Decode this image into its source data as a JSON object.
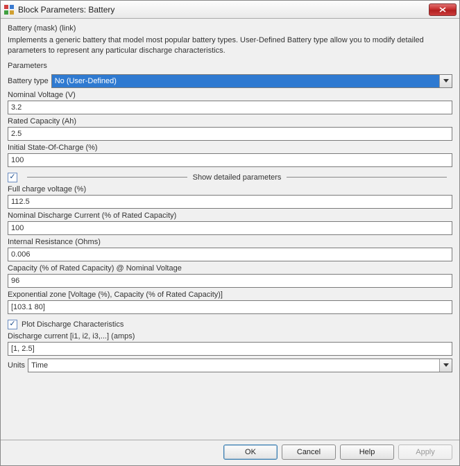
{
  "title": "Block Parameters: Battery",
  "mask_heading": "Battery (mask) (link)",
  "description": "Implements a generic battery that model most popular battery types. User-Defined Battery type allow you to modify detailed parameters  to represent any particular discharge characteristics.",
  "parameters_heading": "Parameters",
  "battery_type": {
    "label": "Battery type",
    "value": "No (User-Defined)"
  },
  "fields": {
    "nominal_voltage": {
      "label": "Nominal Voltage (V)",
      "value": "3.2"
    },
    "rated_capacity": {
      "label": "Rated Capacity (Ah)",
      "value": "2.5"
    },
    "initial_soc": {
      "label": "Initial State-Of-Charge (%)",
      "value": "100"
    }
  },
  "show_detailed_label": "Show detailed parameters",
  "detailed": {
    "full_charge_voltage": {
      "label": "Full charge voltage (%)",
      "value": "112.5"
    },
    "nominal_discharge_current": {
      "label": "Nominal Discharge Current (% of Rated Capacity)",
      "value": "100"
    },
    "internal_resistance": {
      "label": "Internal Resistance (Ohms)",
      "value": "0.006"
    },
    "capacity_nominal_voltage": {
      "label": "Capacity (% of Rated Capacity) @ Nominal Voltage",
      "value": "96"
    },
    "exponential_zone": {
      "label": "Exponential zone [Voltage (%), Capacity (% of Rated Capacity)]",
      "value": "[103.1 80]"
    }
  },
  "plot_discharge": {
    "label": "Plot Discharge Characteristics"
  },
  "discharge_current": {
    "label": "Discharge current [i1, i2, i3,...] (amps)",
    "value": "[1, 2.5]"
  },
  "units": {
    "label": "Units",
    "value": "Time"
  },
  "buttons": {
    "ok": "OK",
    "cancel": "Cancel",
    "help": "Help",
    "apply": "Apply"
  }
}
